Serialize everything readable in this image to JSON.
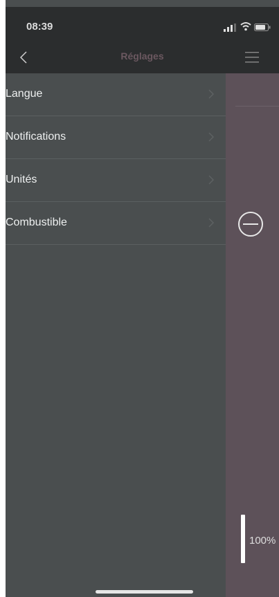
{
  "status_bar": {
    "time": "08:39"
  },
  "nav": {
    "title": "Réglages",
    "back_icon": "chevron-left-icon",
    "menu_icon": "hamburger-menu-icon"
  },
  "menu": {
    "items": [
      {
        "label": "Langue"
      },
      {
        "label": "Notifications"
      },
      {
        "label": "Unités"
      },
      {
        "label": "Combustible"
      }
    ]
  },
  "panel": {
    "level_text": "100%",
    "level_fraction": 1.0
  },
  "colors": {
    "menu_background": "#4a4e4f",
    "bar_background": "#2b2d2e",
    "accent": "#6b5860",
    "panel_background": "#5d5159"
  }
}
